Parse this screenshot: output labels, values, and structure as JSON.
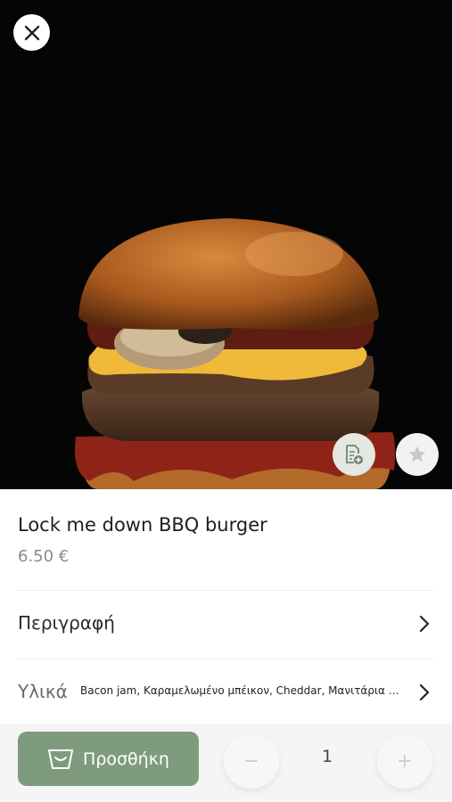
{
  "product": {
    "name": "Lock me down BBQ burger",
    "price": "6.50 €"
  },
  "rows": {
    "description_label": "Περιγραφή",
    "ingredients_label": "Υλικά",
    "ingredients_text": "Bacon jam, Καραμελωμένο μπέικον, Cheddar, Μανιτάρια σ..."
  },
  "cart": {
    "add_label": "Προσθήκη",
    "quantity": "1",
    "minus_label": "−",
    "plus_label": "+"
  },
  "icons": {
    "close": "close-icon",
    "note": "note-add-icon",
    "favorite": "star-icon",
    "basket": "basket-icon",
    "chevron": "chevron-right-icon"
  },
  "colors": {
    "accent": "#7e9b7e",
    "hero_background": "#050505",
    "price": "#8a8a8a"
  }
}
